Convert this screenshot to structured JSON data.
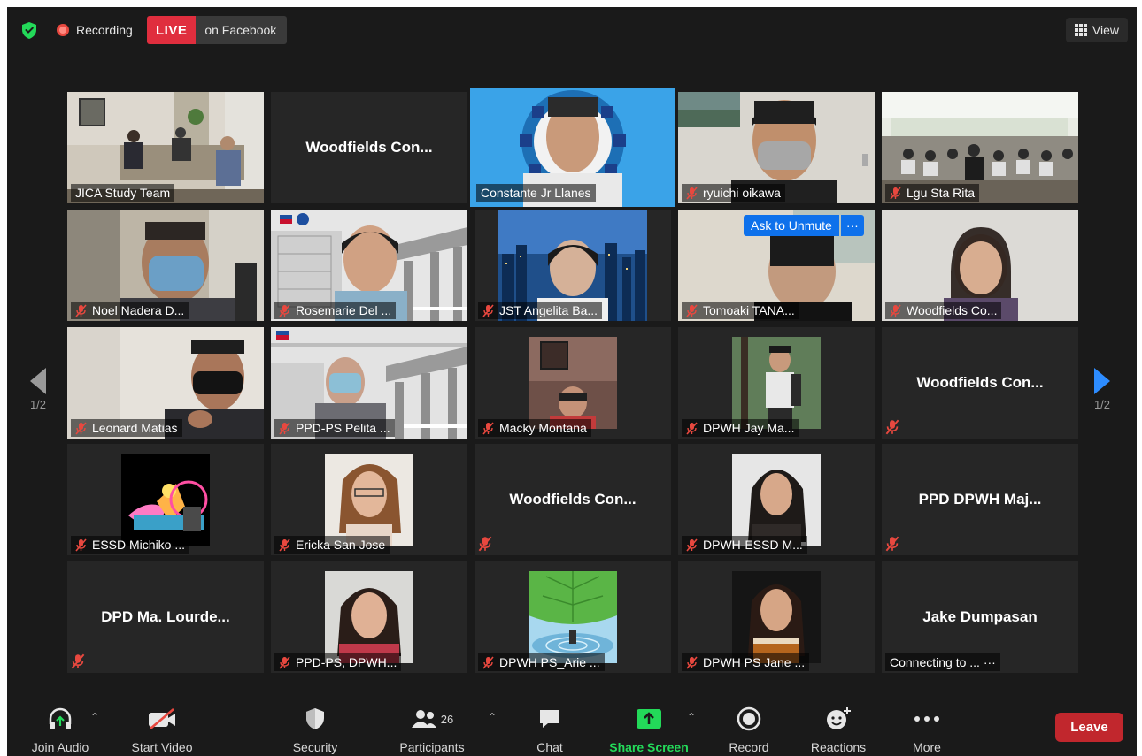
{
  "top_bar": {
    "recording_label": "Recording",
    "live_label": "LIVE",
    "facebook_label": "on Facebook",
    "view_label": "View"
  },
  "pagination": {
    "left_page": "1/2",
    "right_page": "1/2"
  },
  "speaker_tile": "Constante Jr Llanes",
  "tiles": [
    {
      "id": "jica",
      "label": "JICA Study Team",
      "muted": false,
      "kind": "video"
    },
    {
      "id": "woodfields1",
      "name": "Woodfields  Con...",
      "muted": false,
      "kind": "name"
    },
    {
      "id": "constante",
      "label": "Constante Jr Llanes",
      "muted": false,
      "kind": "video"
    },
    {
      "id": "ryuichi",
      "label": "ryuichi oikawa",
      "muted": true,
      "kind": "video"
    },
    {
      "id": "lgu",
      "label": "Lgu Sta Rita",
      "muted": true,
      "kind": "video"
    },
    {
      "id": "noel",
      "label": "Noel Nadera D...",
      "muted": true,
      "kind": "video"
    },
    {
      "id": "rosemarie",
      "label": "Rosemarie Del ...",
      "muted": true,
      "kind": "video"
    },
    {
      "id": "angelita",
      "label": "JST Angelita Ba...",
      "muted": true,
      "kind": "video"
    },
    {
      "id": "tomoaki",
      "label": "Tomoaki TANA...",
      "muted": true,
      "kind": "video"
    },
    {
      "id": "woodfields2",
      "label": "Woodfields Co...",
      "muted": true,
      "kind": "video"
    },
    {
      "id": "leonard",
      "label": "Leonard Matias",
      "muted": true,
      "kind": "video"
    },
    {
      "id": "pelita",
      "label": "PPD-PS Pelita ...",
      "muted": true,
      "kind": "video"
    },
    {
      "id": "macky",
      "label": "Macky Montana",
      "muted": true,
      "kind": "photo"
    },
    {
      "id": "jayma",
      "label": "DPWH Jay Ma...",
      "muted": true,
      "kind": "photo"
    },
    {
      "id": "woodfields3",
      "name": "Woodfields  Con...",
      "muted": true,
      "kind": "name"
    },
    {
      "id": "essd",
      "label": "ESSD Michiko ...",
      "muted": true,
      "kind": "photo"
    },
    {
      "id": "ericka",
      "label": "Ericka San Jose",
      "muted": true,
      "kind": "photo"
    },
    {
      "id": "woodfields4",
      "name": "Woodfields  Con...",
      "muted": true,
      "kind": "name"
    },
    {
      "id": "essdm",
      "label": "DPWH-ESSD M...",
      "muted": true,
      "kind": "photo"
    },
    {
      "id": "ppdmaj",
      "name": "PPD  DPWH  Maj...",
      "muted": true,
      "kind": "name"
    },
    {
      "id": "dpd",
      "name": "DPD  Ma.  Lourde...",
      "muted": true,
      "kind": "name"
    },
    {
      "id": "ppdps",
      "label": "PPD-PS, DPWH...",
      "muted": true,
      "kind": "photo"
    },
    {
      "id": "arie",
      "label": "DPWH PS_Arie ...",
      "muted": true,
      "kind": "photo"
    },
    {
      "id": "jane",
      "label": "DPWH PS Jane ...",
      "muted": true,
      "kind": "photo"
    },
    {
      "id": "jake",
      "name": "Jake Dumpasan",
      "label": "Connecting to ... ···",
      "muted": false,
      "kind": "name"
    }
  ],
  "ask_unmute": {
    "label": "Ask to Unmute",
    "more": "···"
  },
  "toolbar": {
    "join_audio": "Join Audio",
    "start_video": "Start Video",
    "security": "Security",
    "participants": "Participants",
    "participants_count": "26",
    "chat": "Chat",
    "share_screen": "Share Screen",
    "record": "Record",
    "reactions": "Reactions",
    "more": "More",
    "leave": "Leave"
  },
  "colors": {
    "background": "#1a1a1a",
    "tile": "#262626",
    "live": "#e02e3e",
    "share_screen": "#23d959",
    "leave": "#c1272d",
    "speaker_outline": "#d9e77a",
    "ask_unmute": "#0e71eb",
    "pager_active": "#2d8cff"
  }
}
